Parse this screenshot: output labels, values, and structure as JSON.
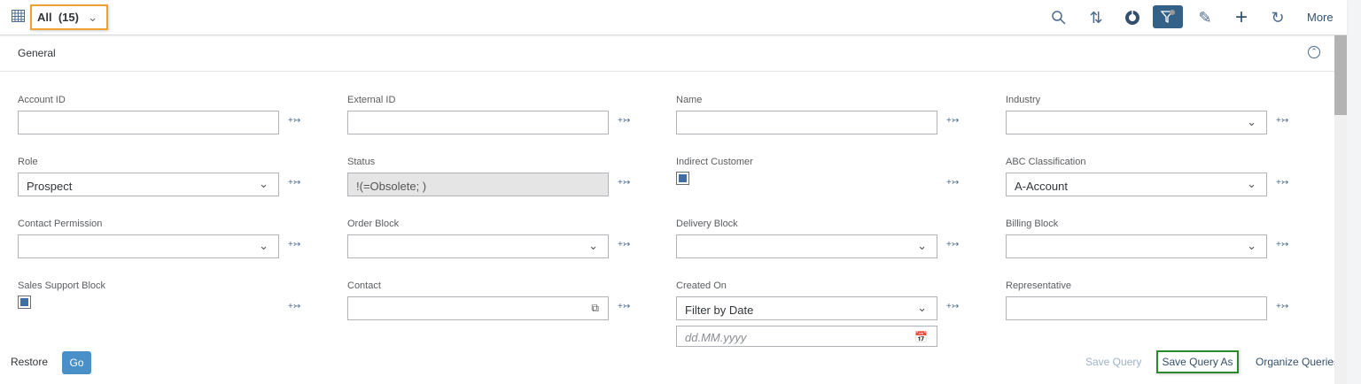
{
  "toolbar": {
    "variant": "All  (15)",
    "more": "More",
    "icons": [
      "search-icon",
      "sort-icon",
      "chart-icon",
      "filter-icon",
      "edit-icon",
      "add-icon",
      "refresh-icon"
    ]
  },
  "section": {
    "title": "General"
  },
  "fields": [
    {
      "label": "Account ID",
      "type": "text",
      "value": ""
    },
    {
      "label": "External ID",
      "type": "text",
      "value": ""
    },
    {
      "label": "Name",
      "type": "text",
      "value": ""
    },
    {
      "label": "Industry",
      "type": "select",
      "value": ""
    },
    {
      "label": "Role",
      "type": "select",
      "value": "Prospect"
    },
    {
      "label": "Status",
      "type": "readonly",
      "value": "!(=Obsolete; )"
    },
    {
      "label": "Indirect Customer",
      "type": "checkbox",
      "value": "checked"
    },
    {
      "label": "ABC Classification",
      "type": "select",
      "value": "A-Account"
    },
    {
      "label": "Contact Permission",
      "type": "select",
      "value": ""
    },
    {
      "label": "Order Block",
      "type": "select",
      "value": ""
    },
    {
      "label": "Delivery Block",
      "type": "select",
      "value": ""
    },
    {
      "label": "Billing Block",
      "type": "select",
      "value": ""
    },
    {
      "label": "Sales Support Block",
      "type": "checkbox",
      "value": "checked"
    },
    {
      "label": "Contact",
      "type": "valuehelp",
      "value": ""
    },
    {
      "label": "Created On",
      "type": "select",
      "value": "Filter by Date"
    },
    {
      "label": "Representative",
      "type": "text",
      "value": ""
    }
  ],
  "date_placeholder": "dd.MM.yyyy",
  "footer": {
    "restore": "Restore",
    "go": "Go",
    "save_query": "Save Query",
    "save_query_as": "Save Query As",
    "organize": "Organize Queries"
  }
}
